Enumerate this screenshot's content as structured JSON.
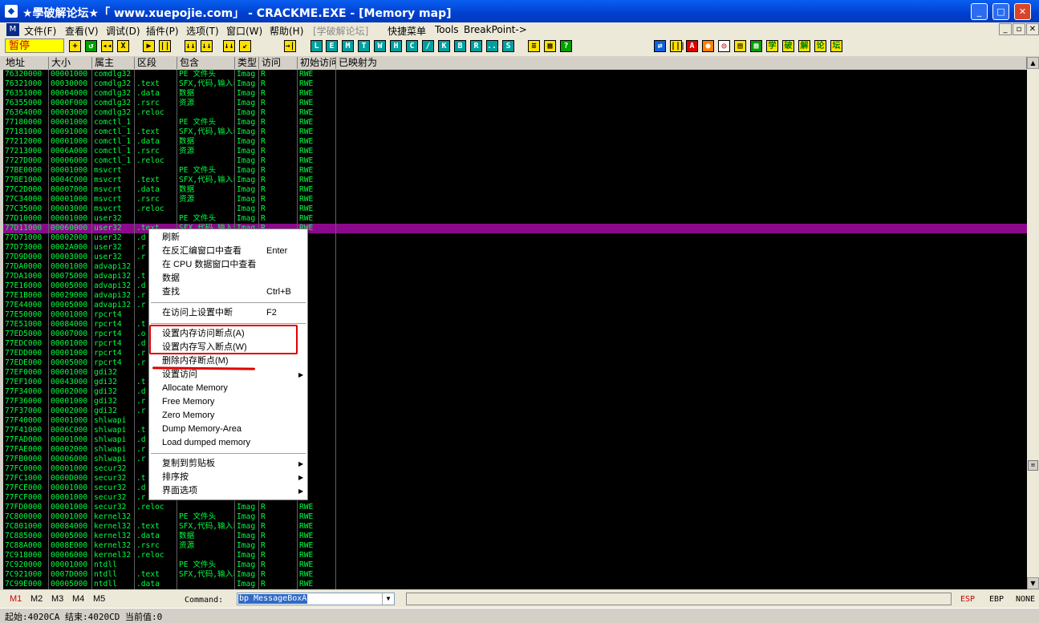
{
  "window": {
    "title": "★學破解论坛★「 www.xuepojie.com」 - CRACKME.EXE - [Memory map]",
    "buttons": [
      "_",
      "□",
      "✕"
    ]
  },
  "menu": {
    "items": [
      "文件(F)",
      "查看(V)",
      "调试(D)",
      "插件(P)",
      "选项(T)",
      "窗口(W)",
      "帮助(H)",
      "[学破解论坛]",
      "快捷菜单",
      "Tools",
      "BreakPoint->"
    ],
    "mdi_buttons": [
      "_",
      "▫",
      "✕"
    ]
  },
  "toolbar": {
    "status": "暂停",
    "buttons": [
      "+",
      "↺",
      "◂◂",
      "X",
      "▶",
      "||",
      "↓↓",
      "↓↓",
      "↓↓",
      "↙",
      "→|",
      "L",
      "E",
      "M",
      "T",
      "W",
      "H",
      "C",
      "/",
      "K",
      "B",
      "R",
      "...",
      "S",
      "≡",
      "▦",
      "?"
    ],
    "buttons_right": [
      "⇄",
      "|||",
      "A",
      "●",
      "◎",
      "▤",
      "▦",
      "学",
      "破",
      "解",
      "论",
      "坛"
    ]
  },
  "columns": [
    "地址",
    "大小",
    "属主",
    "区段",
    "包含",
    "类型",
    "访问",
    "初始访问",
    "已映射为"
  ],
  "rows": [
    [
      "76320000",
      "00001000",
      "comdlg32",
      "",
      "PE 文件头",
      "Imag",
      "R",
      "RWE"
    ],
    [
      "76321000",
      "00030000",
      "comdlg32",
      ".text",
      "SFX,代码,输入表",
      "Imag",
      "R",
      "RWE"
    ],
    [
      "76351000",
      "00004000",
      "comdlg32",
      ".data",
      "数据",
      "Imag",
      "R",
      "RWE"
    ],
    [
      "76355000",
      "0000F000",
      "comdlg32",
      ".rsrc",
      "资源",
      "Imag",
      "R",
      "RWE"
    ],
    [
      "76364000",
      "00003000",
      "comdlg32",
      ".reloc",
      "",
      "Imag",
      "R",
      "RWE"
    ],
    [
      "77180000",
      "00001000",
      "comctl_1",
      "",
      "PE 文件头",
      "Imag",
      "R",
      "RWE"
    ],
    [
      "77181000",
      "00091000",
      "comctl_1",
      ".text",
      "SFX,代码,输入表",
      "Imag",
      "R",
      "RWE"
    ],
    [
      "77212000",
      "00001000",
      "comctl_1",
      ".data",
      "数据",
      "Imag",
      "R",
      "RWE"
    ],
    [
      "77213000",
      "0006A000",
      "comctl_1",
      ".rsrc",
      "资源",
      "Imag",
      "R",
      "RWE"
    ],
    [
      "7727D000",
      "00006000",
      "comctl_1",
      ".reloc",
      "",
      "Imag",
      "R",
      "RWE"
    ],
    [
      "77BE0000",
      "00001000",
      "msvcrt",
      "",
      "PE 文件头",
      "Imag",
      "R",
      "RWE"
    ],
    [
      "77BE1000",
      "0004C000",
      "msvcrt",
      ".text",
      "SFX,代码,输入表",
      "Imag",
      "R",
      "RWE"
    ],
    [
      "77C2D000",
      "00007000",
      "msvcrt",
      ".data",
      "数据",
      "Imag",
      "R",
      "RWE"
    ],
    [
      "77C34000",
      "00001000",
      "msvcrt",
      ".rsrc",
      "资源",
      "Imag",
      "R",
      "RWE"
    ],
    [
      "77C35000",
      "00003000",
      "msvcrt",
      ".reloc",
      "",
      "Imag",
      "R",
      "RWE"
    ],
    [
      "77D10000",
      "00001000",
      "user32",
      "",
      "PE 文件头",
      "Imag",
      "R",
      "RWE"
    ],
    [
      "77D11000",
      "00060000",
      "user32",
      ".text",
      "SFX,代码,输入表",
      "Imag",
      "R",
      "RWE"
    ],
    [
      "77D71000",
      "00002000",
      "user32",
      ".d",
      "",
      "",
      "",
      "E"
    ],
    [
      "77D73000",
      "0002A000",
      "user32",
      ".r",
      "",
      "",
      "",
      "E"
    ],
    [
      "77D9D000",
      "00003000",
      "user32",
      ".r",
      "",
      "",
      "",
      "E"
    ],
    [
      "77DA0000",
      "00001000",
      "advapi32",
      "",
      "",
      "",
      "",
      "E"
    ],
    [
      "77DA1000",
      "00075000",
      "advapi32",
      ".t",
      "",
      "",
      "",
      "E"
    ],
    [
      "77E16000",
      "00005000",
      "advapi32",
      ".d",
      "",
      "",
      "",
      "E"
    ],
    [
      "77E1B000",
      "00029000",
      "advapi32",
      ".r",
      "",
      "",
      "",
      "E"
    ],
    [
      "77E44000",
      "00005000",
      "advapi32",
      ".r",
      "",
      "",
      "",
      "E"
    ],
    [
      "77E50000",
      "00001000",
      "rpcrt4",
      "",
      "",
      "",
      "",
      "E"
    ],
    [
      "77E51000",
      "00084000",
      "rpcrt4",
      ".t",
      "",
      "",
      "",
      "E"
    ],
    [
      "77ED5000",
      "00007000",
      "rpcrt4",
      ".o",
      "",
      "",
      "",
      "E"
    ],
    [
      "77EDC000",
      "00001000",
      "rpcrt4",
      ".d",
      "",
      "",
      "",
      "E"
    ],
    [
      "77EDD000",
      "00001000",
      "rpcrt4",
      ".r",
      "",
      "",
      "",
      "E"
    ],
    [
      "77EDE000",
      "00005000",
      "rpcrt4",
      ".r",
      "",
      "",
      "",
      "E"
    ],
    [
      "77EF0000",
      "00001000",
      "gdi32",
      "",
      "",
      "",
      "",
      "E"
    ],
    [
      "77EF1000",
      "00043000",
      "gdi32",
      ".t",
      "",
      "",
      "",
      "E"
    ],
    [
      "77F34000",
      "00002000",
      "gdi32",
      ".d",
      "",
      "",
      "",
      "E"
    ],
    [
      "77F36000",
      "00001000",
      "gdi32",
      ".r",
      "",
      "",
      "",
      "E"
    ],
    [
      "77F37000",
      "00002000",
      "gdi32",
      ".r",
      "",
      "",
      "",
      "E"
    ],
    [
      "77F40000",
      "00001000",
      "shlwapi",
      "",
      "",
      "",
      "",
      "E"
    ],
    [
      "77F41000",
      "0006C000",
      "shlwapi",
      ".t",
      "",
      "",
      "",
      "E"
    ],
    [
      "77FAD000",
      "00001000",
      "shlwapi",
      ".d",
      "",
      "",
      "",
      "E"
    ],
    [
      "77FAE000",
      "00002000",
      "shlwapi",
      ".r",
      "",
      "",
      "",
      "E"
    ],
    [
      "77FB0000",
      "00006000",
      "shlwapi",
      ".r",
      "",
      "",
      "",
      "E"
    ],
    [
      "77FC0000",
      "00001000",
      "secur32",
      "",
      "",
      "",
      "",
      "E"
    ],
    [
      "77FC1000",
      "0000D000",
      "secur32",
      ".t",
      "",
      "",
      "",
      "E"
    ],
    [
      "77FCE000",
      "00001000",
      "secur32",
      ".d",
      "",
      "",
      "",
      "E"
    ],
    [
      "77FCF000",
      "00001000",
      "secur32",
      ".r",
      "",
      "",
      "",
      "E"
    ],
    [
      "77FD0000",
      "00001000",
      "secur32",
      ".reloc",
      "",
      "Imag",
      "R",
      "RWE"
    ],
    [
      "7C800000",
      "00001000",
      "kernel32",
      "",
      "PE 文件头",
      "Imag",
      "R",
      "RWE"
    ],
    [
      "7C801000",
      "00084000",
      "kernel32",
      ".text",
      "SFX,代码,输入表",
      "Imag",
      "R",
      "RWE"
    ],
    [
      "7C885000",
      "00005000",
      "kernel32",
      ".data",
      "数据",
      "Imag",
      "R",
      "RWE"
    ],
    [
      "7C88A000",
      "0008E000",
      "kernel32",
      ".rsrc",
      "资源",
      "Imag",
      "R",
      "RWE"
    ],
    [
      "7C918000",
      "00006000",
      "kernel32",
      ".reloc",
      "",
      "Imag",
      "R",
      "RWE"
    ],
    [
      "7C920000",
      "00001000",
      "ntdll",
      "",
      "PE 文件头",
      "Imag",
      "R",
      "RWE"
    ],
    [
      "7C921000",
      "0007D000",
      "ntdll",
      ".text",
      "SFX,代码,输入表",
      "Imag",
      "R",
      "RWE"
    ],
    [
      "7C99E000",
      "00005000",
      "ntdll",
      ".data",
      "",
      "Imag",
      "R",
      "RWE"
    ]
  ],
  "selected_row": 16,
  "context_menu": {
    "items": [
      {
        "label": "刷新",
        "shortcut": "",
        "submenu": false
      },
      {
        "label": "在反汇编窗口中查看",
        "shortcut": "Enter",
        "submenu": false
      },
      {
        "label": "在 CPU 数据窗口中查看",
        "shortcut": "",
        "submenu": false
      },
      {
        "label": "数据",
        "shortcut": "",
        "submenu": false
      },
      {
        "label": "查找",
        "shortcut": "Ctrl+B",
        "submenu": false
      },
      {
        "label": "在访问上设置中断",
        "shortcut": "F2",
        "submenu": false
      },
      {
        "label": "设置内存访问断点(A)",
        "shortcut": "",
        "submenu": false
      },
      {
        "label": "设置内存写入断点(W)",
        "shortcut": "",
        "submenu": false
      },
      {
        "label": "删除内存断点(M)",
        "shortcut": "",
        "submenu": false
      },
      {
        "label": "设置访问",
        "shortcut": "",
        "submenu": true
      },
      {
        "label": "Allocate Memory",
        "shortcut": "",
        "submenu": false
      },
      {
        "label": "Free Memory",
        "shortcut": "",
        "submenu": false
      },
      {
        "label": "Zero Memory",
        "shortcut": "",
        "submenu": false
      },
      {
        "label": "Dump Memory-Area",
        "shortcut": "",
        "submenu": false
      },
      {
        "label": "Load dumped memory",
        "shortcut": "",
        "submenu": false
      },
      {
        "label": "复制到剪贴板",
        "shortcut": "",
        "submenu": true
      },
      {
        "label": "排序按",
        "shortcut": "",
        "submenu": true
      },
      {
        "label": "界面选项",
        "shortcut": "",
        "submenu": true
      }
    ],
    "submenu_arrow": "▶"
  },
  "command_bar": {
    "tabs": [
      "M1",
      "M2",
      "M3",
      "M4",
      "M5"
    ],
    "label": "Command:",
    "value": "bp MessageBoxA",
    "dropdown": "▼",
    "registers": [
      "ESP",
      "EBP",
      "NONE"
    ]
  },
  "status": "起始:4020CA 结束:4020CD 当前值:0",
  "scroll": {
    "up": "▲",
    "down": "▼",
    "thumb": "≡"
  },
  "colors": {
    "text": "#00ff40",
    "selection": "#8b0a8b",
    "annotation": "#e00000"
  }
}
